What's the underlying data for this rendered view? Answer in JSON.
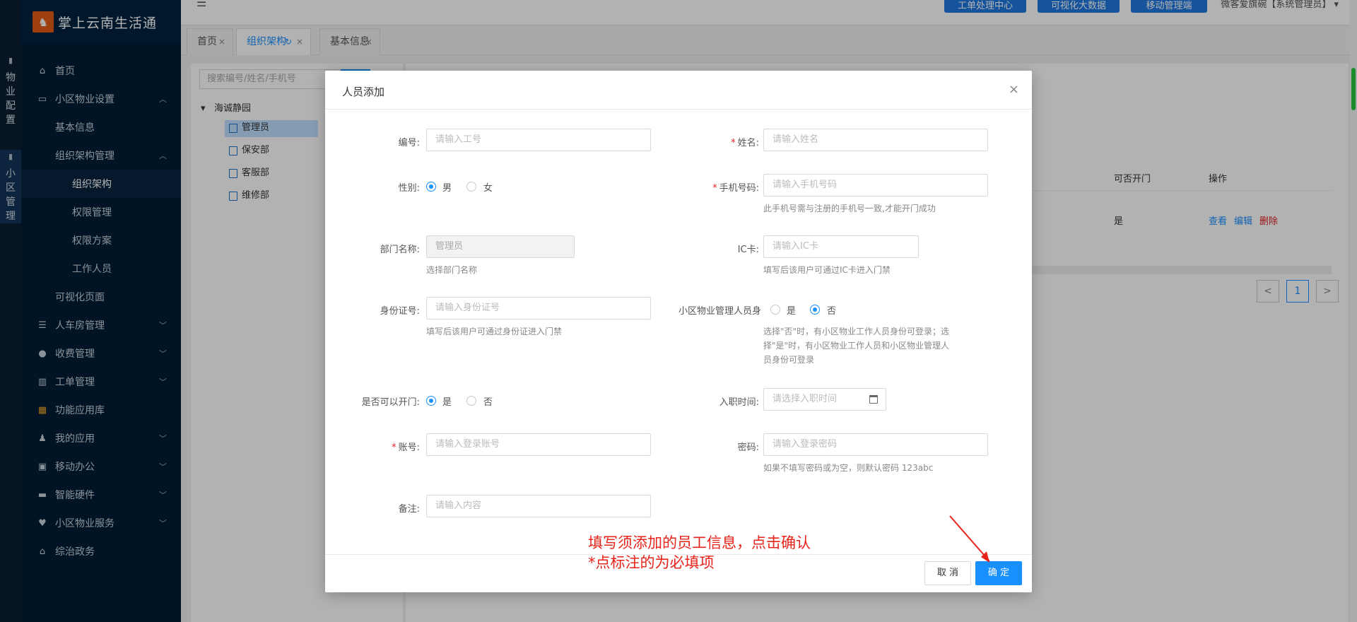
{
  "app": {
    "name": "掌上云南生活通"
  },
  "rail": {
    "items": [
      {
        "icon": "document-icon",
        "chars": [
          "物",
          "业",
          "配",
          "置"
        ]
      },
      {
        "icon": "document-icon",
        "chars": [
          "小",
          "区",
          "管",
          "理"
        ]
      }
    ]
  },
  "sidebar": {
    "items": [
      {
        "label": "首页",
        "icon": "home-icon"
      },
      {
        "label": "小区物业设置",
        "icon": "monitor-icon",
        "expanded": true
      },
      {
        "label": "基本信息"
      },
      {
        "label": "组织架构管理",
        "expanded": true
      },
      {
        "label": "组织架构",
        "active": true
      },
      {
        "label": "权限管理"
      },
      {
        "label": "权限方案"
      },
      {
        "label": "工作人员"
      },
      {
        "label": "可视化页面"
      },
      {
        "label": "人车房管理",
        "icon": "database-icon"
      },
      {
        "label": "收费管理",
        "icon": "money-bag-icon"
      },
      {
        "label": "工单管理",
        "icon": "columns-icon"
      },
      {
        "label": "功能应用库",
        "icon": "apps-icon"
      },
      {
        "label": "我的应用",
        "icon": "user-icon"
      },
      {
        "label": "移动办公",
        "icon": "briefcase-icon"
      },
      {
        "label": "智能硬件",
        "icon": "keyboard-icon"
      },
      {
        "label": "小区物业服务",
        "icon": "hand-heart-icon"
      },
      {
        "label": "综治政务",
        "icon": "bank-icon"
      }
    ]
  },
  "topbar": {
    "buttons": [
      "工单处理中心",
      "可视化大数据",
      "移动管理端"
    ],
    "user": "微客爱旗碗【系统管理员】"
  },
  "tabs": [
    {
      "label": "首页"
    },
    {
      "label": "组织架构",
      "active": true
    },
    {
      "label": "基本信息"
    }
  ],
  "left_panel": {
    "search_placeholder": "搜索编号/姓名/手机号",
    "tree_root": "海诚静园",
    "tree_nodes": [
      "管理员",
      "保安部",
      "客服部",
      "维修部"
    ]
  },
  "table": {
    "headers": [
      "可否开门",
      "操作"
    ],
    "row": {
      "can_open": "是",
      "actions": [
        "查看",
        "编辑",
        "删除"
      ]
    },
    "pagination": {
      "prev": "<",
      "current": "1",
      "next": ">"
    }
  },
  "modal": {
    "title": "人员添加",
    "close": "×",
    "fields": {
      "id": {
        "label": "编号:",
        "placeholder": "请输入工号"
      },
      "name": {
        "label": "姓名:",
        "placeholder": "请输入姓名",
        "required": "*"
      },
      "gender": {
        "label": "性别:",
        "options": [
          "男",
          "女"
        ],
        "selected": "男"
      },
      "phone": {
        "label": "手机号码:",
        "placeholder": "请输入手机号码",
        "required": "*",
        "hint": "此手机号需与注册的手机号一致,才能开门成功"
      },
      "dept": {
        "label": "部门名称:",
        "value": "管理员",
        "hint": "选择部门名称"
      },
      "ic_card": {
        "label": "IC卡:",
        "placeholder": "请输入IC卡",
        "hint": "填写后该用户可通过IC卡进入门禁"
      },
      "id_card": {
        "label": "身份证号:",
        "placeholder": "请输入身份证号",
        "hint": "填写后该用户可通过身份证进入门禁"
      },
      "is_manager": {
        "label": "小区物业管理人员身",
        "options": [
          "是",
          "否"
        ],
        "selected": "否",
        "hint_lines": [
          "选择\"否\"时，有小区物业工作人员身份可登录；选",
          "择\"是\"时，有小区物业工作人员和小区物业管理人",
          "员身份可登录"
        ]
      },
      "can_open": {
        "label": "是否可以开门:",
        "options": [
          "是",
          "否"
        ],
        "selected": "是"
      },
      "hire_date": {
        "label": "入职时间:",
        "placeholder": "请选择入职时间"
      },
      "account": {
        "label": "账号:",
        "placeholder": "请输入登录账号",
        "required": "*"
      },
      "password": {
        "label": "密码:",
        "placeholder": "请输入登录密码",
        "hint": "如果不填写密码或为空，则默认密码 123abc"
      },
      "remark": {
        "label": "备注:",
        "placeholder": "请输入内容"
      }
    },
    "buttons": {
      "cancel": "取 消",
      "ok": "确 定"
    }
  },
  "annotation": {
    "line1": "填写须添加的员工信息，点击确认",
    "line2": "*点标注的为必填项",
    "color": "#e8231a"
  }
}
